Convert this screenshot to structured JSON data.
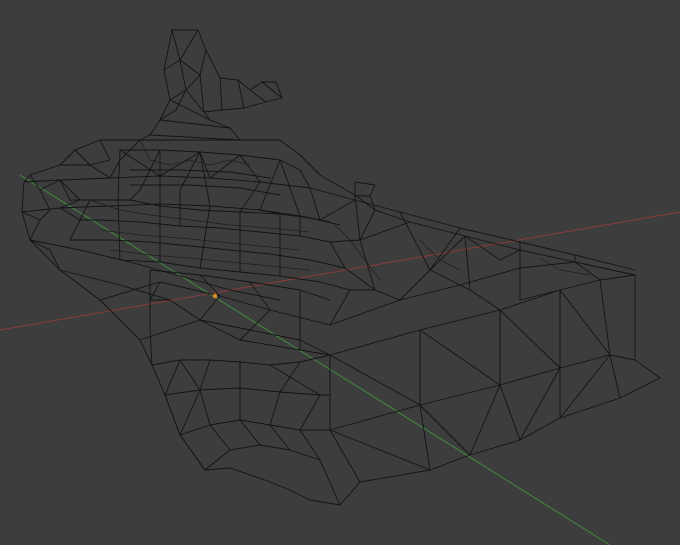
{
  "viewport": {
    "background_color": "#3d3d3d",
    "wire_color": "#141414",
    "x_axis_color": "#8a3a3a",
    "y_axis_color": "#3f8a3f",
    "origin_color": "#e08a2a",
    "object": "wireframe-mesh"
  }
}
